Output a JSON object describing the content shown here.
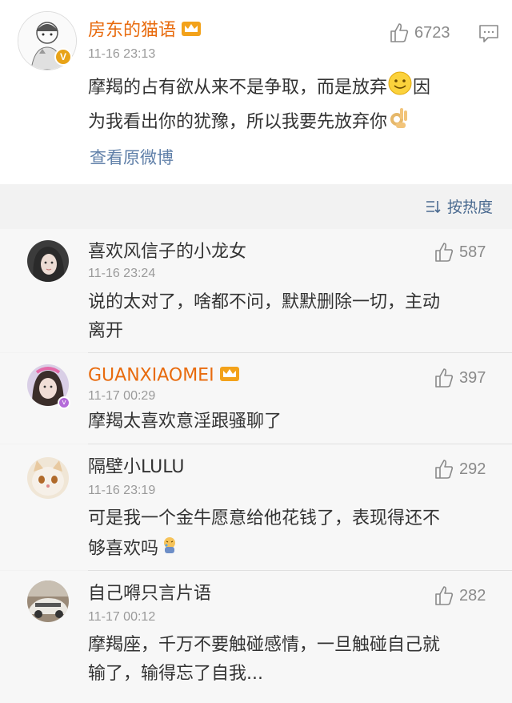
{
  "post": {
    "author": "房东的猫语",
    "time": "11-16 23:13",
    "text_line1": "摩羯的占有欲从来不是争取，而是放弃",
    "text_line1b": "因",
    "text_line2": "为我看出你的犹豫，所以我要先放弃你",
    "likes": "6723",
    "view_original": "查看原微博"
  },
  "sort": {
    "label": "按热度"
  },
  "comments": [
    {
      "author": "喜欢风信子的小龙女",
      "time": "11-16 23:24",
      "likes": "587",
      "line1": "说的太对了，啥都不问，默默删除一切，主动",
      "line2": "离开"
    },
    {
      "author": "GUANXIAOMEI",
      "time": "11-17 00:29",
      "likes": "397",
      "line1": "摩羯太喜欢意淫跟骚聊了"
    },
    {
      "author": "隔壁小LULU",
      "time": "11-16 23:19",
      "likes": "292",
      "line1": "可是我一个金牛愿意给他花钱了，表现得还不",
      "line2": "够喜欢吗"
    },
    {
      "author": "自己嘚只言片语",
      "time": "11-17 00:12",
      "likes": "282",
      "line1": "摩羯座，千万不要触碰感情，一旦触碰自己就",
      "line2": "输了，输得忘了自我..."
    }
  ],
  "colors": {
    "accent_name": "#e86b0e",
    "link": "#5f7fa8",
    "badge": "#e8a318"
  },
  "icons": [
    "thumb-up-icon",
    "comment-icon",
    "crown-icon",
    "smile-emoji-icon",
    "ok-hand-emoji-icon",
    "sort-icon",
    "verified-badge-icon",
    "vip-badge-icon",
    "cry-emoji-icon"
  ]
}
